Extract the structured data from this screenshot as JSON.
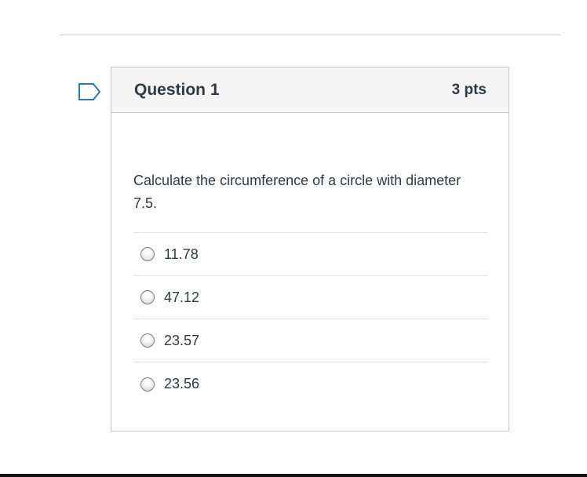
{
  "question": {
    "title": "Question 1",
    "points": "3 pts",
    "text": "Calculate the circumference of a circle with diameter 7.5.",
    "answers": [
      {
        "label": "11.78"
      },
      {
        "label": "47.12"
      },
      {
        "label": "23.57"
      },
      {
        "label": "23.56"
      }
    ]
  },
  "icons": {
    "flag": "flag-outline-icon"
  },
  "colors": {
    "text": "#2d3b45",
    "flag": "#2b7abc",
    "header_bg": "#f5f5f5",
    "border": "#c8c8c8"
  }
}
